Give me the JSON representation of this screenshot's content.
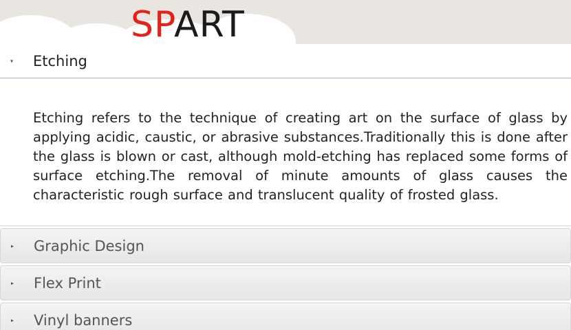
{
  "logo": {
    "part1": "SP",
    "part2": "ART"
  },
  "accordion": {
    "items": [
      {
        "label": "Etching",
        "expanded": true,
        "content": "Etching refers to the technique of creating art on the surface of glass by applying acidic, caustic, or abrasive substances.Traditionally this is done after the glass is blown or cast, although mold-etching has replaced some forms of surface etching.The removal of minute amounts of glass causes the characteristic rough surface and translucent quality of frosted glass."
      },
      {
        "label": "Graphic Design",
        "expanded": false
      },
      {
        "label": "Flex Print",
        "expanded": false
      },
      {
        "label": "Vinyl banners",
        "expanded": false
      }
    ],
    "icons": {
      "expanded": "▾",
      "collapsed": "▸"
    }
  },
  "colors": {
    "brand_red": "#e2231a",
    "brand_dark": "#1b1b1b"
  }
}
